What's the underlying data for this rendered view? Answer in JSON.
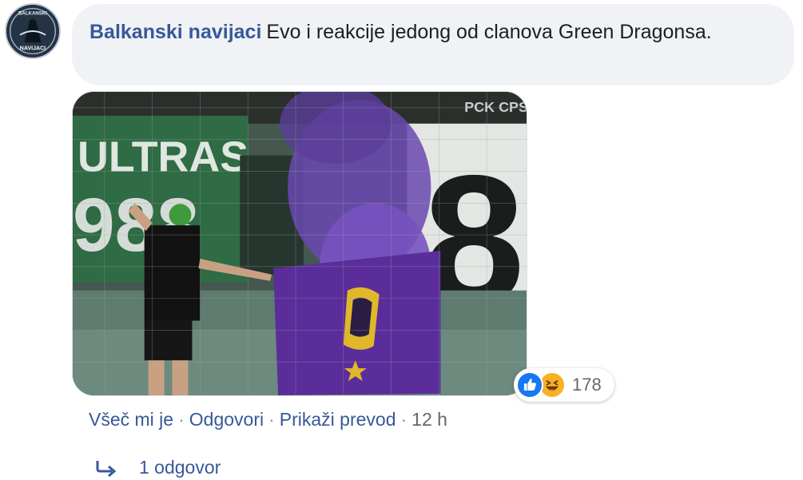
{
  "comment": {
    "author": "Balkanski navijaci",
    "text": "Evo i reakcije jedong od clanova Green Dragonsa.",
    "avatar_text": [
      "BALKANSKI",
      "NAVIJACI"
    ],
    "photo_text": {
      "banner_left": "ULTRAS",
      "banner_left_number": "988",
      "banner_right_number": "8",
      "top_corner": "PCK CPS"
    }
  },
  "reactions": {
    "icons": [
      "like-icon",
      "haha-icon"
    ],
    "count": "178"
  },
  "actions": {
    "like": "Všeč mi je",
    "reply": "Odgovori",
    "translate": "Prikaži prevod",
    "time": "12 h",
    "separator": "·"
  },
  "replies": {
    "label": "1 odgovor"
  },
  "colors": {
    "link": "#385898",
    "bubble": "#f0f2f5",
    "like": "#1877f2",
    "haha": "#f7b125"
  }
}
